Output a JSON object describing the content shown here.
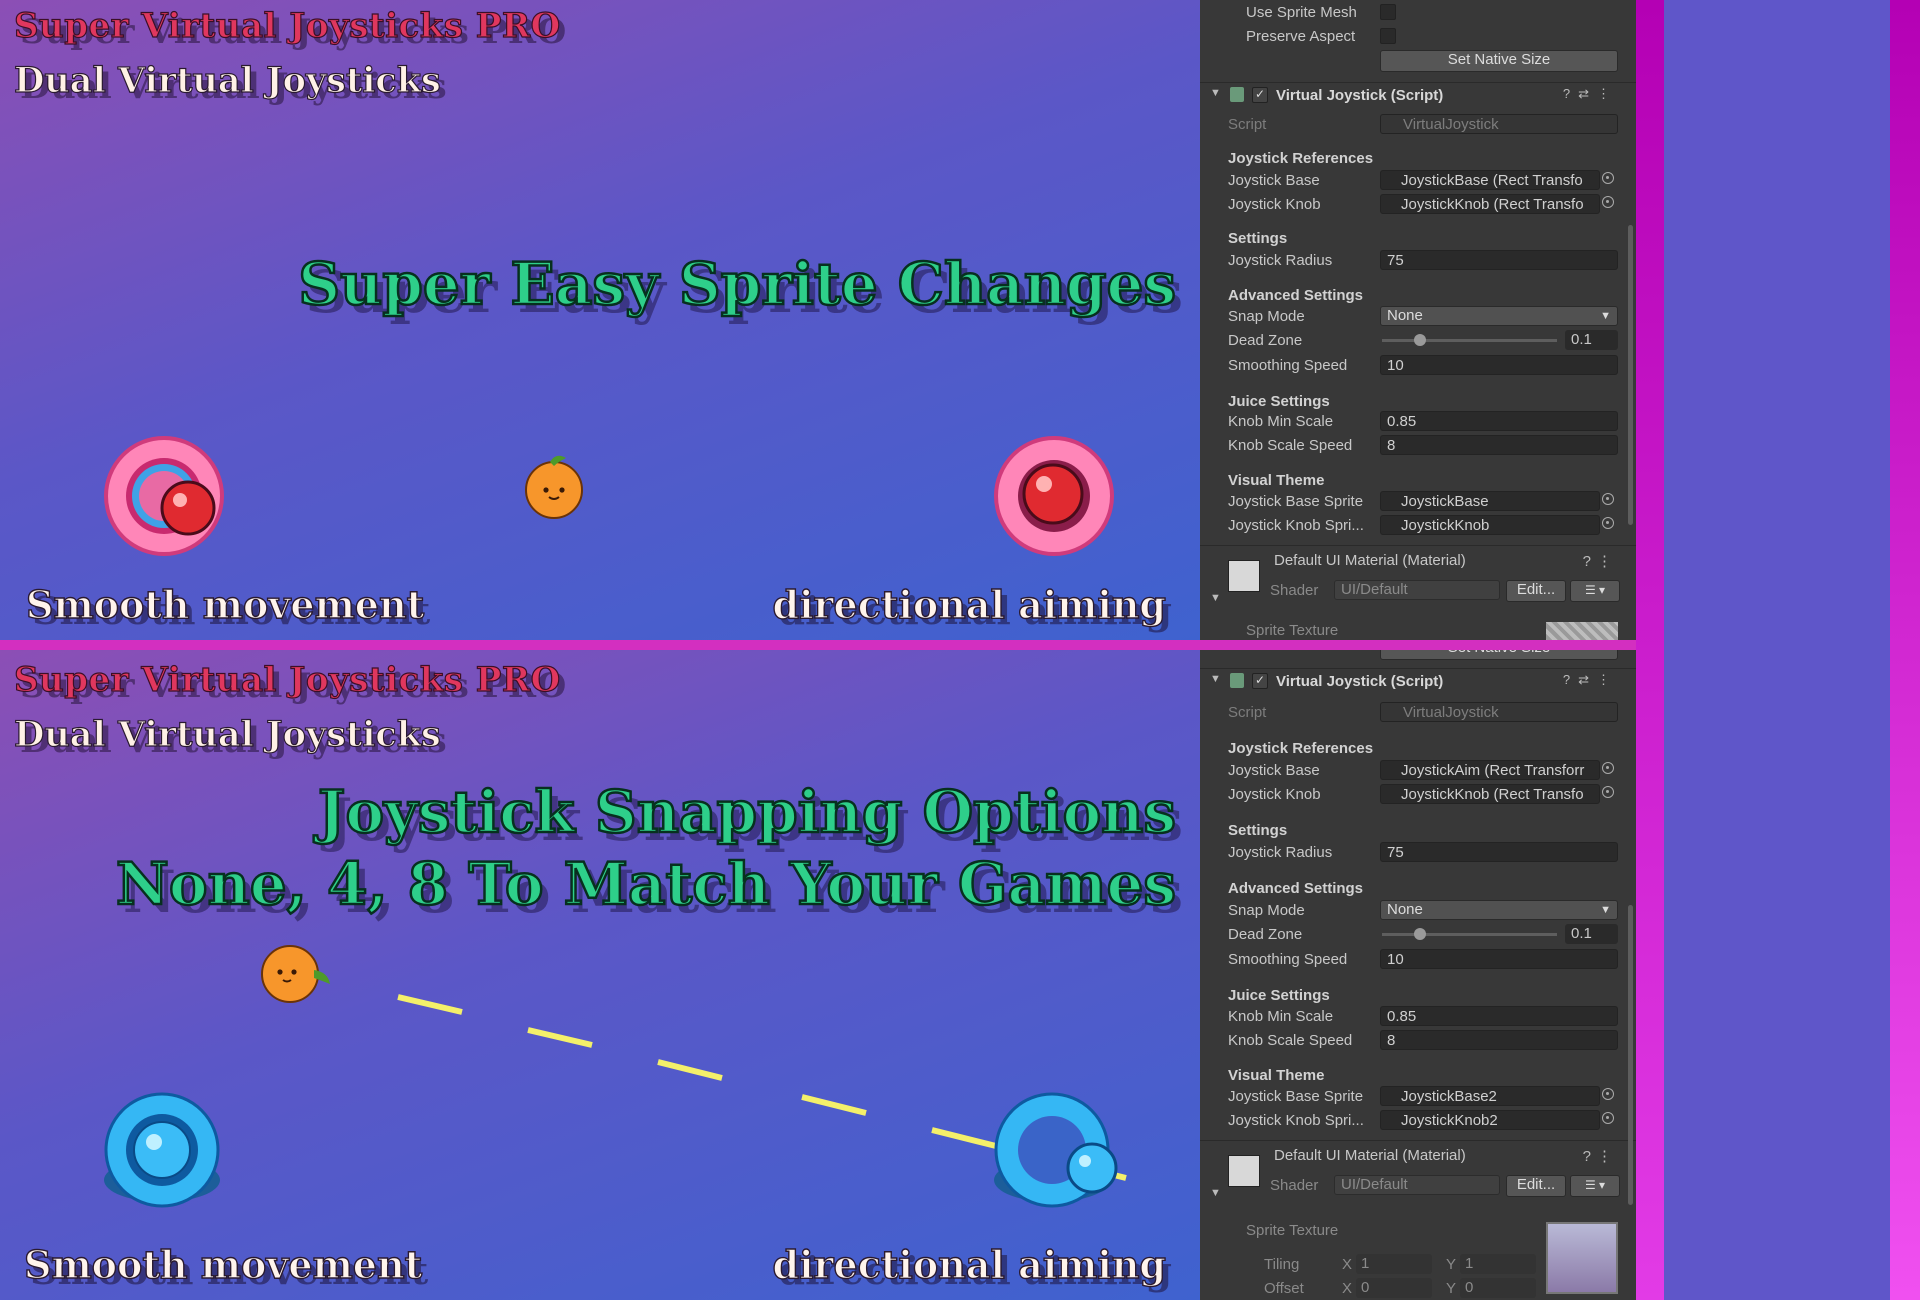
{
  "top": {
    "brand": "Super Virtual Joysticks PRO",
    "subtitle": "Dual Virtual Joysticks",
    "headline": "Super Easy Sprite Changes",
    "caption_left": "Smooth movement",
    "caption_right": "directional aiming",
    "inspector": {
      "use_sprite_mesh": "Use Sprite Mesh",
      "preserve_aspect": "Preserve Aspect",
      "set_native_size": "Set Native Size",
      "component_title": "Virtual Joystick (Script)",
      "script_label": "Script",
      "script_value": "VirtualJoystick",
      "refs_header": "Joystick References",
      "base_label": "Joystick Base",
      "base_value": "JoystickBase (Rect Transfo",
      "knob_label": "Joystick Knob",
      "knob_value": "JoystickKnob (Rect Transfo",
      "settings_header": "Settings",
      "radius_label": "Joystick Radius",
      "radius_value": "75",
      "advanced_header": "Advanced Settings",
      "snap_label": "Snap Mode",
      "snap_value": "None",
      "deadzone_label": "Dead Zone",
      "deadzone_value": "0.1",
      "smoothing_label": "Smoothing Speed",
      "smoothing_value": "10",
      "juice_header": "Juice Settings",
      "minscale_label": "Knob Min Scale",
      "minscale_value": "0.85",
      "scalespeed_label": "Knob Scale Speed",
      "scalespeed_value": "8",
      "theme_header": "Visual Theme",
      "basesprite_label": "Joystick Base Sprite",
      "basesprite_value": "JoystickBase",
      "knobsprite_label": "Joystick Knob Spri...",
      "knobsprite_value": "JoystickKnob",
      "material_title": "Default UI Material (Material)",
      "shader_label": "Shader",
      "shader_value": "UI/Default",
      "edit_label": "Edit...",
      "sprite_texture_label": "Sprite Texture"
    }
  },
  "bottom": {
    "brand": "Super Virtual Joysticks PRO",
    "subtitle": "Dual Virtual Joysticks",
    "headline1": "Joystick Snapping Options",
    "headline2": "None, 4, 8 To Match Your Games",
    "caption_left": "Smooth movement",
    "caption_right": "directional aiming",
    "inspector": {
      "set_native_size": "Set Native Size",
      "component_title": "Virtual Joystick (Script)",
      "script_label": "Script",
      "script_value": "VirtualJoystick",
      "refs_header": "Joystick References",
      "base_label": "Joystick Base",
      "base_value": "JoystickAim (Rect Transforr",
      "knob_label": "Joystick Knob",
      "knob_value": "JoystickKnob (Rect Transfo",
      "settings_header": "Settings",
      "radius_label": "Joystick Radius",
      "radius_value": "75",
      "advanced_header": "Advanced Settings",
      "snap_label": "Snap Mode",
      "snap_value": "None",
      "deadzone_label": "Dead Zone",
      "deadzone_value": "0.1",
      "smoothing_label": "Smoothing Speed",
      "smoothing_value": "10",
      "juice_header": "Juice Settings",
      "minscale_label": "Knob Min Scale",
      "minscale_value": "0.85",
      "scalespeed_label": "Knob Scale Speed",
      "scalespeed_value": "8",
      "theme_header": "Visual Theme",
      "basesprite_label": "Joystick Base Sprite",
      "basesprite_value": "JoystickBase2",
      "knobsprite_label": "Joystick Knob Spri...",
      "knobsprite_value": "JoystickKnob2",
      "material_title": "Default UI Material (Material)",
      "shader_label": "Shader",
      "shader_value": "UI/Default",
      "edit_label": "Edit...",
      "sprite_texture_label": "Sprite Texture",
      "tiling_label": "Tiling",
      "offset_label": "Offset",
      "x_label": "X",
      "y_label": "Y",
      "tiling_x": "1",
      "tiling_y": "1",
      "offset_x": "0",
      "offset_y": "0"
    }
  },
  "colors": {
    "brand_red": "#e0375e",
    "headline_green": "#2ecf8a",
    "divider_magenta": "#d32fc0",
    "editor_bg": "#383838"
  }
}
